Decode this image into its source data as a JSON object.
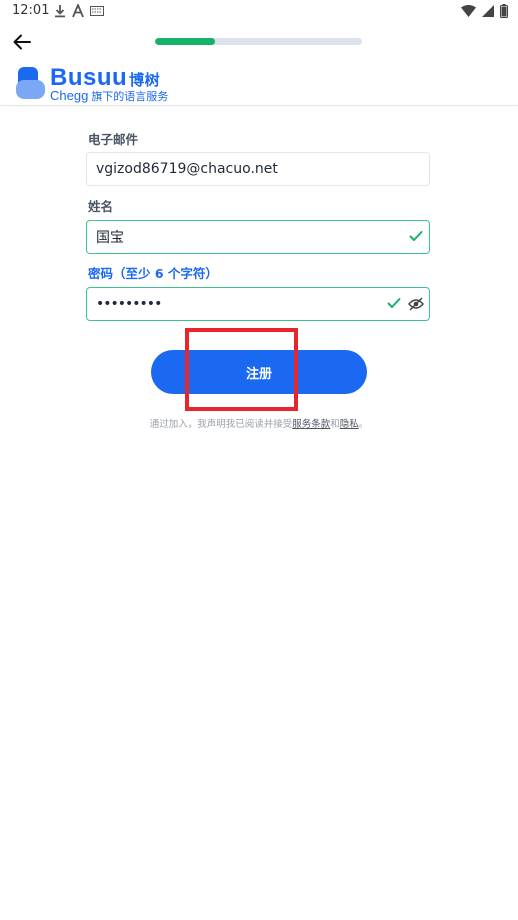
{
  "status_bar": {
    "time": "12:01"
  },
  "header": {
    "progress_percent": 29,
    "brand_name": "Busuu",
    "brand_cn": "博树",
    "sub_brand": "Chegg",
    "sub_text": "旗下的语言服务"
  },
  "form": {
    "email_label": "电子邮件",
    "email_value": "vgizod86719@chacuo.net",
    "name_label": "姓名",
    "name_value": "国宝",
    "password_label": "密码（至少 6 个字符）",
    "password_value": "•••••••••",
    "signup_label": "注册"
  },
  "terms": {
    "prefix": "通过加入，我声明我已阅读并接受",
    "tos_link": "服务条款",
    "and": "和",
    "privacy_link": "隐私",
    "suffix": "。"
  },
  "colors": {
    "brand": "#1a69f0",
    "success": "#17b26a",
    "highlight": "#e7262b"
  }
}
